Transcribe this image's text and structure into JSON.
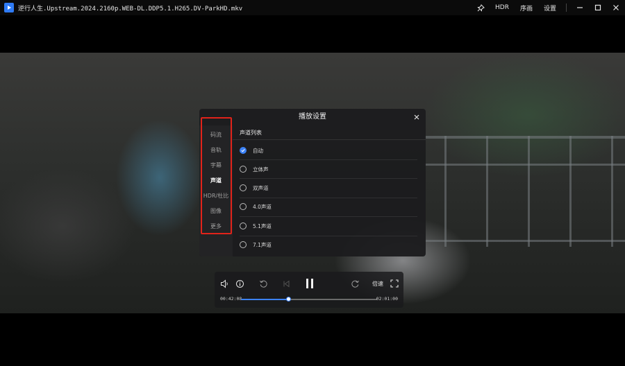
{
  "window": {
    "title": "逆行人生.Upstream.2024.2160p.WEB-DL.DDP5.1.H265.DV-ParkHD.mkv",
    "menu": [
      "HDR",
      "序画",
      "设置"
    ]
  },
  "settings_dialog": {
    "title": "播放设置",
    "nav": [
      "码流",
      "音轨",
      "字幕",
      "声道",
      "HDR/杜比",
      "图像",
      "更多"
    ],
    "active_nav": "声道",
    "section_title": "声道列表",
    "options": [
      "自动",
      "立体声",
      "双声道",
      "4.0声道",
      "5.1声道",
      "7.1声道"
    ],
    "selected_option": "自动",
    "highlight_color": "#e2231a",
    "accent_color": "#3c82f6"
  },
  "player": {
    "current_time": "00:42:08",
    "total_time": "02:01:00",
    "progress": 0.35,
    "speed_label": "倍速"
  }
}
